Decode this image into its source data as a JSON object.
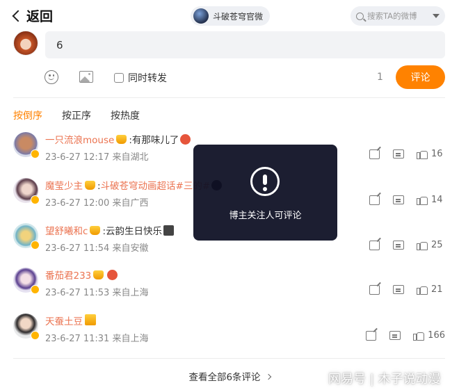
{
  "header": {
    "back_label": "返回",
    "account_name": "斗破苍穹官微",
    "search_placeholder": "搜索TA的微博"
  },
  "composer": {
    "input_value": "6",
    "forward_label": "同时转发",
    "char_count": "1",
    "submit_label": "评论"
  },
  "sort_tabs": [
    {
      "label": "按倒序",
      "active": true
    },
    {
      "label": "按正序",
      "active": false
    },
    {
      "label": "按热度",
      "active": false
    }
  ],
  "comments": [
    {
      "name": "一只流浪mouse",
      "text": ":有那味儿了",
      "meta": "23-6-27 12:17 来自湖北",
      "likes": "16"
    },
    {
      "name": "魔莹少主",
      "text_pre": ":",
      "text_hl": "斗破苍穹动画超话#三的#",
      "meta": "23-6-27 12:00 来自广西",
      "likes": "14"
    },
    {
      "name": "望舒曦和c",
      "text": ":云韵生日快乐",
      "meta": "23-6-27 11:54 来自安徽",
      "likes": "25"
    },
    {
      "name": "番茄君233",
      "text": "",
      "meta": "23-6-27 11:53 来自上海",
      "likes": "21"
    },
    {
      "name": "天蚕土豆",
      "text": "",
      "meta": "23-6-27 11:31 来自上海",
      "likes": "166"
    }
  ],
  "view_all_label": "查看全部6条评论",
  "toast": {
    "message": "博主关注人可评论"
  },
  "watermark": "网易号 | 木子说动漫",
  "colors": {
    "accent": "#ff8200",
    "username": "#eb7350",
    "toast_bg": "#0e1024"
  }
}
